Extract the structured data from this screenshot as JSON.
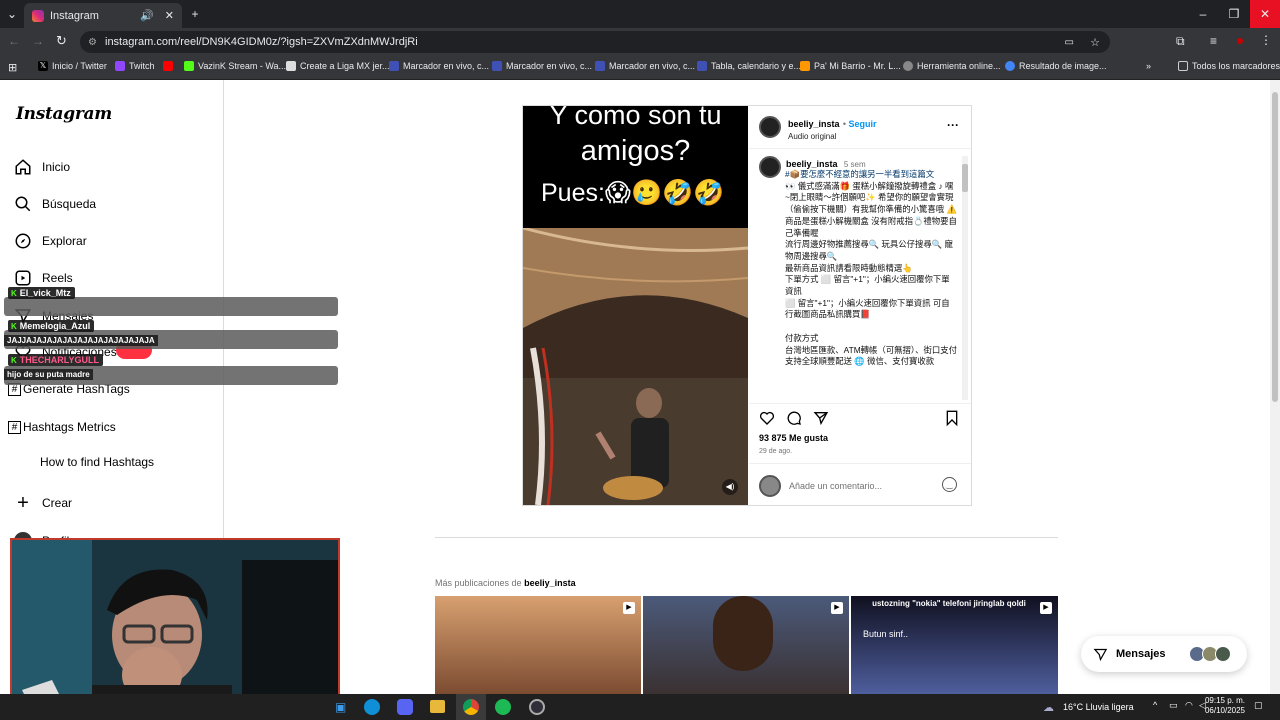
{
  "browser": {
    "tab_title": "Instagram",
    "url": "instagram.com/reel/DN9K4GIDM0z/?igsh=ZXVmZXdnMWJrdjRi",
    "bookmarks": [
      "Inicio / Twitter",
      "Twitch",
      "VazinK Stream - Wa...",
      "Create a Liga MX jer...",
      "Marcador en vivo, c...",
      "Marcador en vivo, c...",
      "Marcador en vivo, c...",
      "Tabla, calendario y e...",
      "Pa' Mi Barrio - Mr. L...",
      "Herramienta online...",
      "Resultado de image..."
    ],
    "all_bookmarks": "Todos los marcadores"
  },
  "sidebar": {
    "logo": "Instagram",
    "items": [
      {
        "label": "Inicio",
        "icon": "home-icon"
      },
      {
        "label": "Búsqueda",
        "icon": "search-icon"
      },
      {
        "label": "Explorar",
        "icon": "compass-icon"
      },
      {
        "label": "Reels",
        "icon": "reels-icon"
      },
      {
        "label": "Mensajes",
        "icon": "messages-icon"
      },
      {
        "label": "Notificaciones",
        "icon": "heart-icon"
      }
    ],
    "generate": "Generate HashTags",
    "metrics": "Hashtags Metrics",
    "howto": "How to find Hashtags",
    "crear": "Crear",
    "perfil": "Perfil"
  },
  "chat": [
    {
      "user": "El_vick_Mtz",
      "message": ""
    },
    {
      "user": "Memelogia_Azul",
      "message": "JAJJAJAJAJAJAJAJAJAJAJAJAJAJA"
    },
    {
      "user": "THECHARLYGULL",
      "message": "hijo de su puta madre"
    }
  ],
  "post": {
    "video_caption_line1": "Y como son tu",
    "video_caption_line2": "amigos?",
    "video_caption_pues": "Pues:😱🥲🤣🤣",
    "username": "beeliy_insta",
    "follow": "Seguir",
    "audio": "Audio original",
    "comment_user": "beeliy_insta",
    "comment_time": "5 sem",
    "caption_link": "#📦要怎麼不經意的讓另一半看到這篇文",
    "caption": "👀 儀式感滿滿🎁 蛋糕小解鐘撥旋轉禮盒 ♪ 嘿~閉上眼睛～許個願吧✨ 希望你的願望會實現（偷偷按下機關）有我幫你準備的小驚喜哦 ⚠️ 商品是蛋糕小解機關盒 沒有附戒指💍禮物要自己準備喔\n流行周邊好物推薦搜尋🔍 玩具公仔搜尋🔍 寵物周邊搜尋🔍\n最新商品資訊請看限時動態精選👆\n下單方式 ⬜ 留言\"+1\"；小編火速回覆你下單資訊\n⬜ 留言\"+1\"；小編火速回覆你下單資訊 可自行截圖商品私訊購買📕\n\n付款方式\n台灣地區匯款、ATM轉帳（可無摺）、街口支付\n支持全球順豐配送 🌐 微信、支付寶收款",
    "likes": "93 875 Me gusta",
    "date": "29 de ago.",
    "comment_placeholder": "Añade un comentario..."
  },
  "more": {
    "prefix": "Más publicaciones de",
    "user": "beeliy_insta"
  },
  "thumbs": [
    {
      "text": ""
    },
    {
      "text": ""
    },
    {
      "text": "ustozning \"nokia\" telefoni jiringlab qoldi",
      "sub": "Butun sinf.."
    }
  ],
  "messages_btn": "Mensajes",
  "taskbar": {
    "weather": "16°C  Lluvia ligera",
    "time": "09:15 p. m.",
    "date": "06/10/2025"
  }
}
